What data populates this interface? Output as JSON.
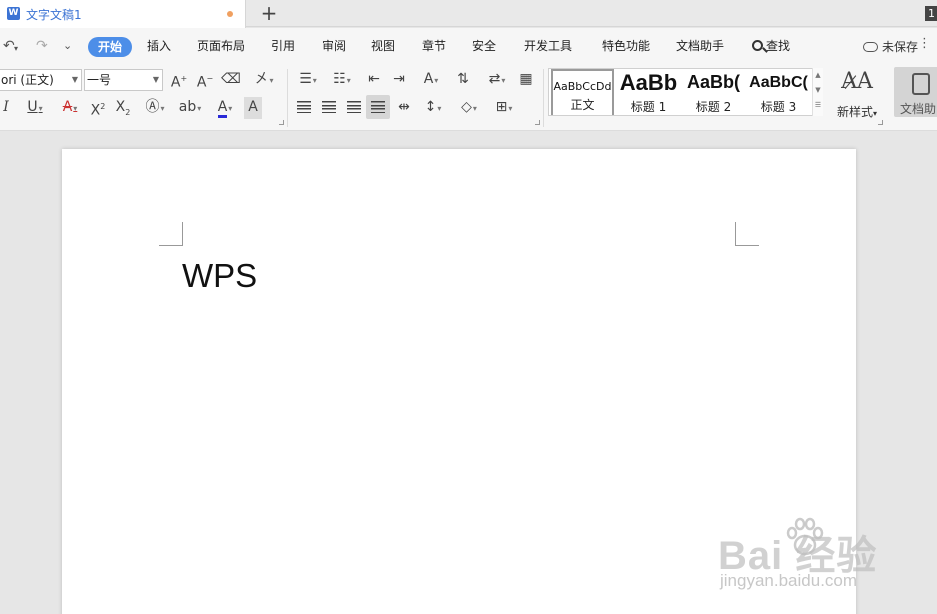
{
  "tabbar": {
    "doc_tab_label": "文字文稿1",
    "new_tab_label": "+",
    "window_count": "1"
  },
  "menubar": {
    "items": [
      "开始",
      "插入",
      "页面布局",
      "引用",
      "审阅",
      "视图",
      "章节",
      "安全",
      "开发工具",
      "特色功能",
      "文档助手"
    ],
    "active_item": "开始",
    "search_label": "查找",
    "save_status": "未保存"
  },
  "ribbon": {
    "font_name": "ori (正文)",
    "font_size": "一号",
    "styles": [
      {
        "sample": "AaBbCcDd",
        "name": "正文"
      },
      {
        "sample": "AaBb",
        "name": "标题 1"
      },
      {
        "sample": "AaBb(",
        "name": "标题 2"
      },
      {
        "sample": "AaBbC(",
        "name": "标题 3"
      }
    ],
    "new_style_label": "新样式",
    "doc_helper_label": "文档助"
  },
  "document": {
    "text": "WPS"
  },
  "watermark": {
    "brand": "Bai  经验",
    "url": "jingyan.baidu.com"
  },
  "colors": {
    "accent": "#4d8ee8",
    "brand_blue": "#3b73d4",
    "unsaved_dot": "#f0a060",
    "font_color_bar": "#2a2ad8"
  }
}
